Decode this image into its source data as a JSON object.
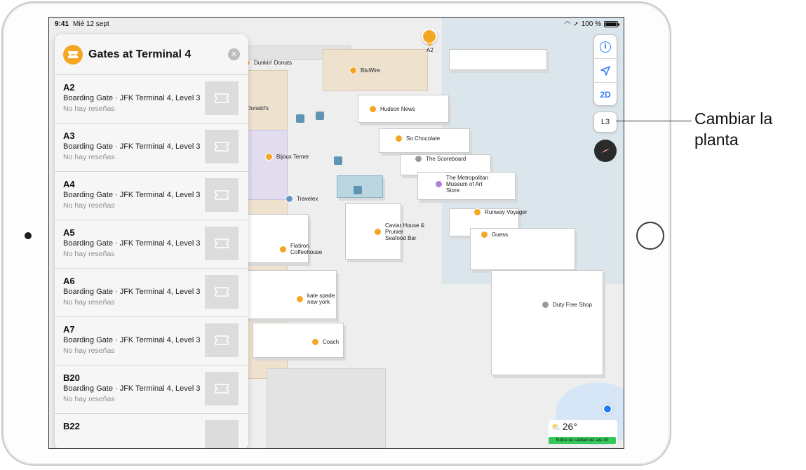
{
  "status_bar": {
    "time": "9:41",
    "date": "Mié 12 sept",
    "battery": "100 %"
  },
  "panel": {
    "title": "Gates at Terminal 4",
    "items": [
      {
        "name": "A2",
        "subtitle": "Boarding Gate · JFK Terminal 4, Level 3",
        "reviews": "No hay reseñas"
      },
      {
        "name": "A3",
        "subtitle": "Boarding Gate · JFK Terminal 4, Level 3",
        "reviews": "No hay reseñas"
      },
      {
        "name": "A4",
        "subtitle": "Boarding Gate · JFK Terminal 4, Level 3",
        "reviews": "No hay reseñas"
      },
      {
        "name": "A5",
        "subtitle": "Boarding Gate · JFK Terminal 4, Level 3",
        "reviews": "No hay reseñas"
      },
      {
        "name": "A6",
        "subtitle": "Boarding Gate · JFK Terminal 4, Level 3",
        "reviews": "No hay reseñas"
      },
      {
        "name": "A7",
        "subtitle": "Boarding Gate · JFK Terminal 4, Level 3",
        "reviews": "No hay reseñas"
      },
      {
        "name": "B20",
        "subtitle": "Boarding Gate · JFK Terminal 4, Level 3",
        "reviews": "No hay reseñas"
      },
      {
        "name": "B22",
        "subtitle": "",
        "reviews": ""
      }
    ]
  },
  "map": {
    "selected_pin": "A2",
    "pois": {
      "dunkin": "Dunkin' Donuts",
      "bluwire": "BluWire",
      "hudson": "Hudson News",
      "donalds": "Donald's",
      "so_chocolate": "So Chocolate",
      "scoreboard": "The Scoreboard",
      "bijoux": "Bijoux Terner",
      "met_museum": "The Metropolitan\nMuseum of Art\nStore",
      "travelex": "Travelex",
      "runway": "Runway Voyager",
      "caviar": "Caviar House &\nPrunier\nSeafood Bar",
      "guess": "Guess",
      "flatiron": "Flatiron\nCoffeehouse",
      "kate_spade": "kate spade\nnew york",
      "duty_free": "Duty Free Shop",
      "coach": "Coach"
    }
  },
  "controls": {
    "view_mode": "2D",
    "floor": "L3"
  },
  "weather": {
    "temperature": "26°",
    "air_quality": "Índice de calidad del aire 40"
  },
  "callout": {
    "text": "Cambiar la planta"
  },
  "colors": {
    "accent": "#2f7cf6",
    "poi": "#f5a623",
    "aqi": "#34c759"
  }
}
